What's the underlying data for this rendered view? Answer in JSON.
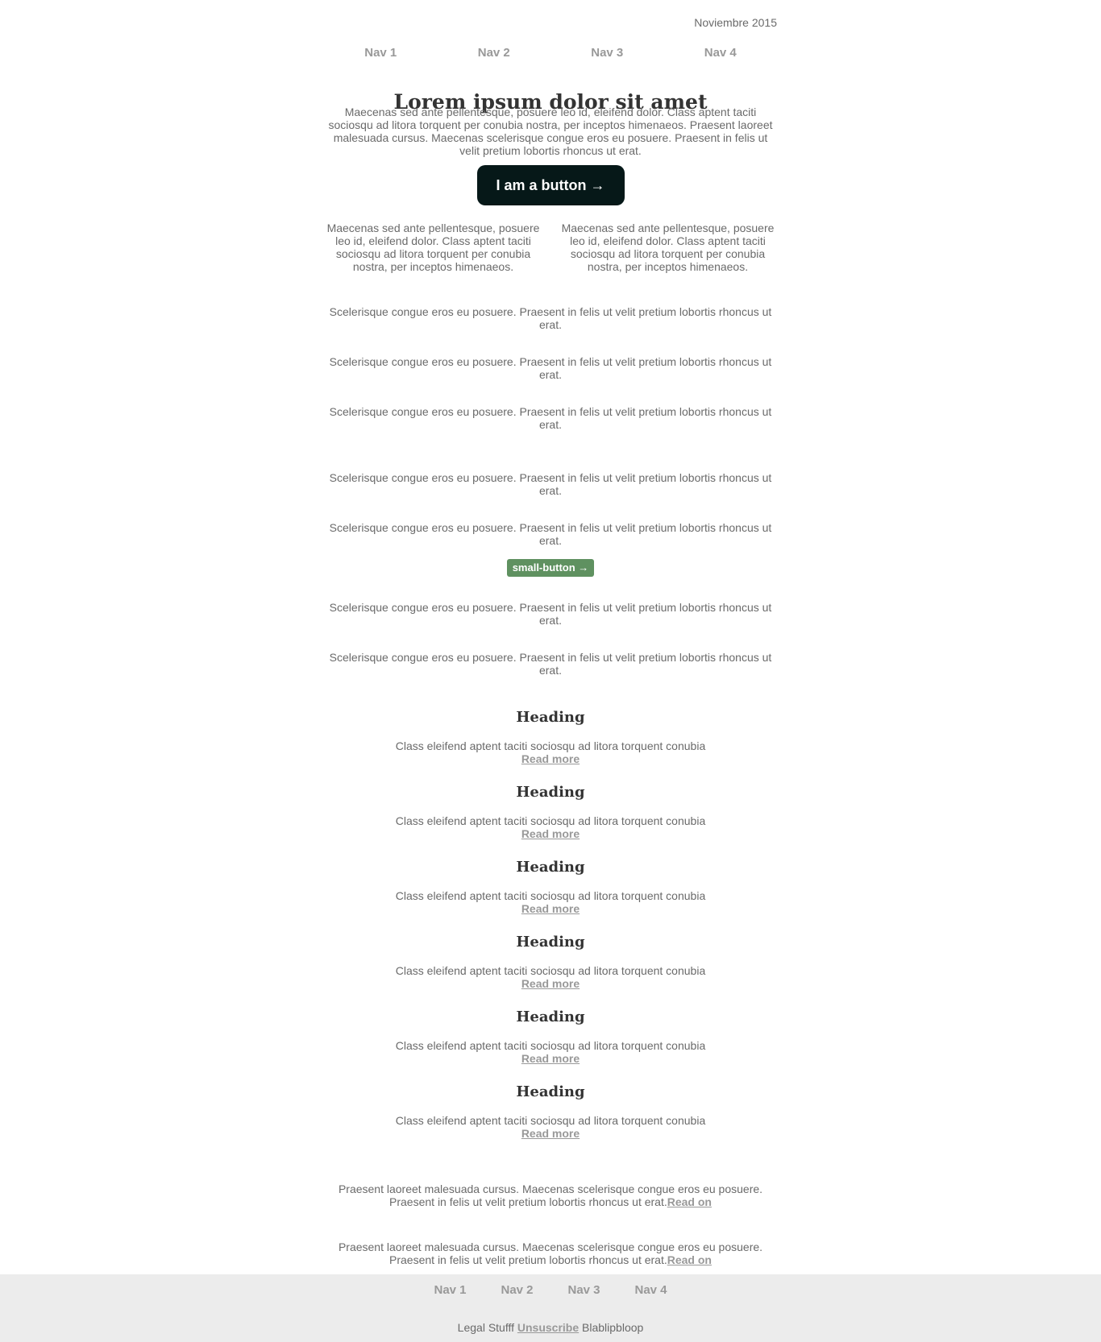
{
  "header": {
    "date": "Noviembre 2015"
  },
  "nav": [
    "Nav 1",
    "Nav 2",
    "Nav 3",
    "Nav 4"
  ],
  "hero": {
    "title": "Lorem ipsum dolor sit amet",
    "text": "Maecenas sed ante pellentesque, posuere leo id, eleifend dolor. Class aptent taciti sociosqu ad litora torquent per conubia nostra, per inceptos himenaeos. Praesent laoreet malesuada cursus. Maecenas scelerisque congue eros eu posuere. Praesent in felis ut velit pretium lobortis rhoncus ut erat.",
    "button": "I am a button →"
  },
  "columns": [
    "Maecenas sed ante pellentesque, posuere leo id, eleifend dolor. Class aptent taciti sociosqu ad litora torquent per conubia nostra, per inceptos himenaeos.",
    "Maecenas sed ante pellentesque, posuere leo id, eleifend dolor. Class aptent taciti sociosqu ad litora torquent per conubia nostra, per inceptos himenaeos."
  ],
  "paragraphs": [
    "Scelerisque congue eros eu posuere. Praesent in felis ut velit pretium lobortis rhoncus ut erat.",
    "Scelerisque congue eros eu posuere. Praesent in felis ut velit pretium lobortis rhoncus ut erat.",
    "Scelerisque congue eros eu posuere. Praesent in felis ut velit pretium lobortis rhoncus ut erat.",
    "Scelerisque congue eros eu posuere. Praesent in felis ut velit pretium lobortis rhoncus ut erat.",
    "Scelerisque congue eros eu posuere. Praesent in felis ut velit pretium lobortis rhoncus ut erat.",
    "Scelerisque congue eros eu posuere. Praesent in felis ut velit pretium lobortis rhoncus ut erat.",
    "Scelerisque congue eros eu posuere. Praesent in felis ut velit pretium lobortis rhoncus ut erat."
  ],
  "small_button": "small-button →",
  "articles": [
    {
      "heading": "Heading",
      "text": "Class eleifend aptent taciti sociosqu ad litora torquent conubia",
      "link": "Read more"
    },
    {
      "heading": "Heading",
      "text": "Class eleifend aptent taciti sociosqu ad litora torquent conubia",
      "link": "Read more"
    },
    {
      "heading": "Heading",
      "text": "Class eleifend aptent taciti sociosqu ad litora torquent conubia",
      "link": "Read more"
    },
    {
      "heading": "Heading",
      "text": "Class eleifend aptent taciti sociosqu ad litora torquent conubia",
      "link": "Read more"
    },
    {
      "heading": "Heading",
      "text": "Class eleifend aptent taciti sociosqu ad litora torquent conubia",
      "link": "Read more"
    },
    {
      "heading": "Heading",
      "text": "Class eleifend aptent taciti sociosqu ad litora torquent conubia",
      "link": "Read more"
    }
  ],
  "teasers": [
    {
      "text": "Praesent laoreet malesuada cursus. Maecenas scelerisque congue eros eu posuere. Praesent in felis ut velit pretium lobortis rhoncus ut erat.",
      "link": "Read on"
    },
    {
      "text": "Praesent laoreet malesuada cursus. Maecenas scelerisque congue eros eu posuere. Praesent in felis ut velit pretium lobortis rhoncus ut erat.",
      "link": "Read on"
    }
  ],
  "footer": {
    "nav": [
      "Nav 1",
      "Nav 2",
      "Nav 3",
      "Nav 4"
    ],
    "legal_prefix": "Legal Stufff",
    "unsubscribe": "Unsuscribe",
    "legal_suffix": "Blablipbloop"
  }
}
